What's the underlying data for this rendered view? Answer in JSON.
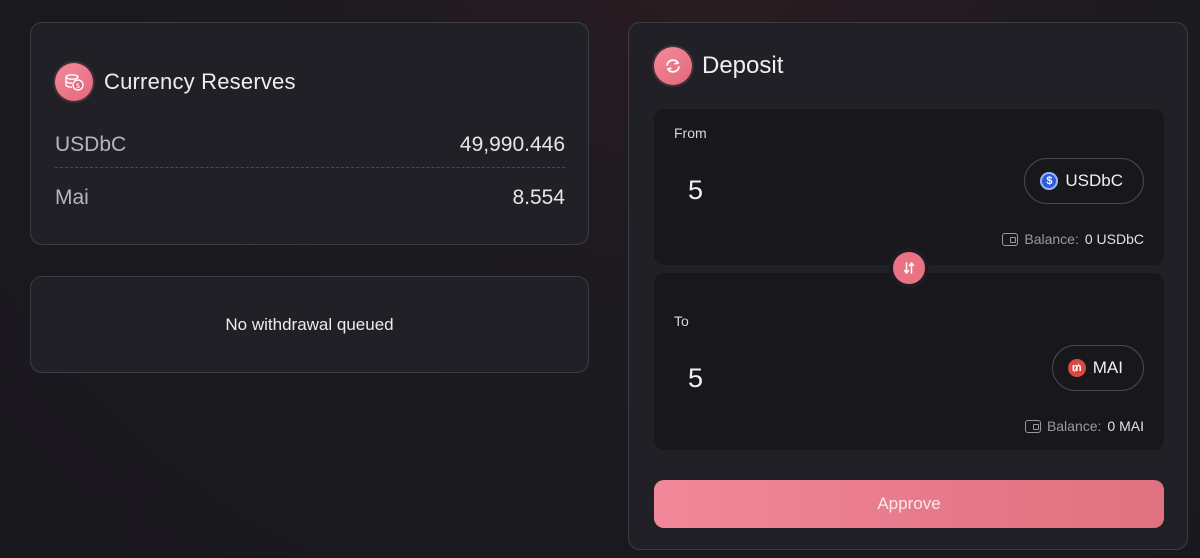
{
  "reserves": {
    "title": "Currency Reserves",
    "icon": "coins-icon",
    "rows": [
      {
        "name": "USDbC",
        "value": "49,990.446"
      },
      {
        "name": "Mai",
        "value": "8.554"
      }
    ]
  },
  "withdrawal": {
    "status_text": "No withdrawal queued"
  },
  "deposit": {
    "title": "Deposit",
    "icon": "swap-circle-icon",
    "from": {
      "label": "From",
      "amount": "5",
      "token": "USDbC",
      "token_icon": "usdbc-icon",
      "balance_label": "Balance:",
      "balance_value": "0 USDbC"
    },
    "to": {
      "label": "To",
      "amount": "5",
      "token": "MAI",
      "token_icon": "mai-icon",
      "balance_label": "Balance:",
      "balance_value": "0 MAI"
    },
    "swap_icon": "swap-arrows-icon",
    "approve_label": "Approve"
  },
  "colors": {
    "accent": "#e97384",
    "card_bg": "#212026",
    "panel_bg": "#18171c",
    "border": "#3d3c46"
  }
}
